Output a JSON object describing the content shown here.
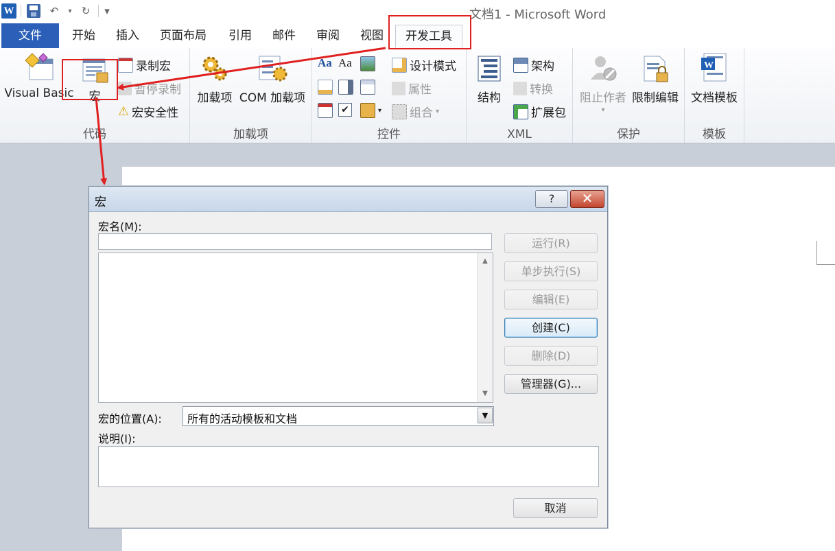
{
  "window": {
    "title": "文档1 - Microsoft Word",
    "logo_letter": "W"
  },
  "quick_access": {
    "undo": "↶",
    "redo": "↻",
    "customize": "▾"
  },
  "tabs": [
    {
      "label": "文件"
    },
    {
      "label": "开始"
    },
    {
      "label": "插入"
    },
    {
      "label": "页面布局"
    },
    {
      "label": "引用"
    },
    {
      "label": "邮件"
    },
    {
      "label": "审阅"
    },
    {
      "label": "视图"
    },
    {
      "label": "开发工具"
    }
  ],
  "ribbon": {
    "code": {
      "label": "代码",
      "visual_basic": "Visual Basic",
      "macros": "宏",
      "record_macro": "录制宏",
      "pause_recording": "暂停录制",
      "macro_security": "宏安全性"
    },
    "addins": {
      "label": "加载项",
      "addins": "加载项",
      "com_addins": "COM 加载项"
    },
    "controls": {
      "label": "控件",
      "design_mode": "设计模式",
      "properties": "属性",
      "group": "组合",
      "aa1": "Aa",
      "aa2": "Aa"
    },
    "xml": {
      "label": "XML",
      "structure": "结构",
      "schema": "架构",
      "transform": "转换",
      "expansion_packs": "扩展包"
    },
    "protect": {
      "label": "保护",
      "block_authors": "阻止作者",
      "restrict_editing": "限制编辑"
    },
    "templates": {
      "label": "模板",
      "document_template": "文档模板"
    }
  },
  "dialog": {
    "title": "宏",
    "help": "?",
    "close": "✕",
    "macro_name_label": "宏名(M):",
    "macro_name_value": "",
    "macros_in_label": "宏的位置(A):",
    "macros_in_value": "所有的活动模板和文档",
    "description_label": "说明(I):",
    "description_value": "",
    "buttons": {
      "run": "运行(R)",
      "step_into": "单步执行(S)",
      "edit": "编辑(E)",
      "create": "创建(C)",
      "delete": "删除(D)",
      "organizer": "管理器(G)...",
      "cancel": "取消"
    }
  },
  "colors": {
    "annotation": "#e02020",
    "file_tab": "#2b5fb8"
  }
}
